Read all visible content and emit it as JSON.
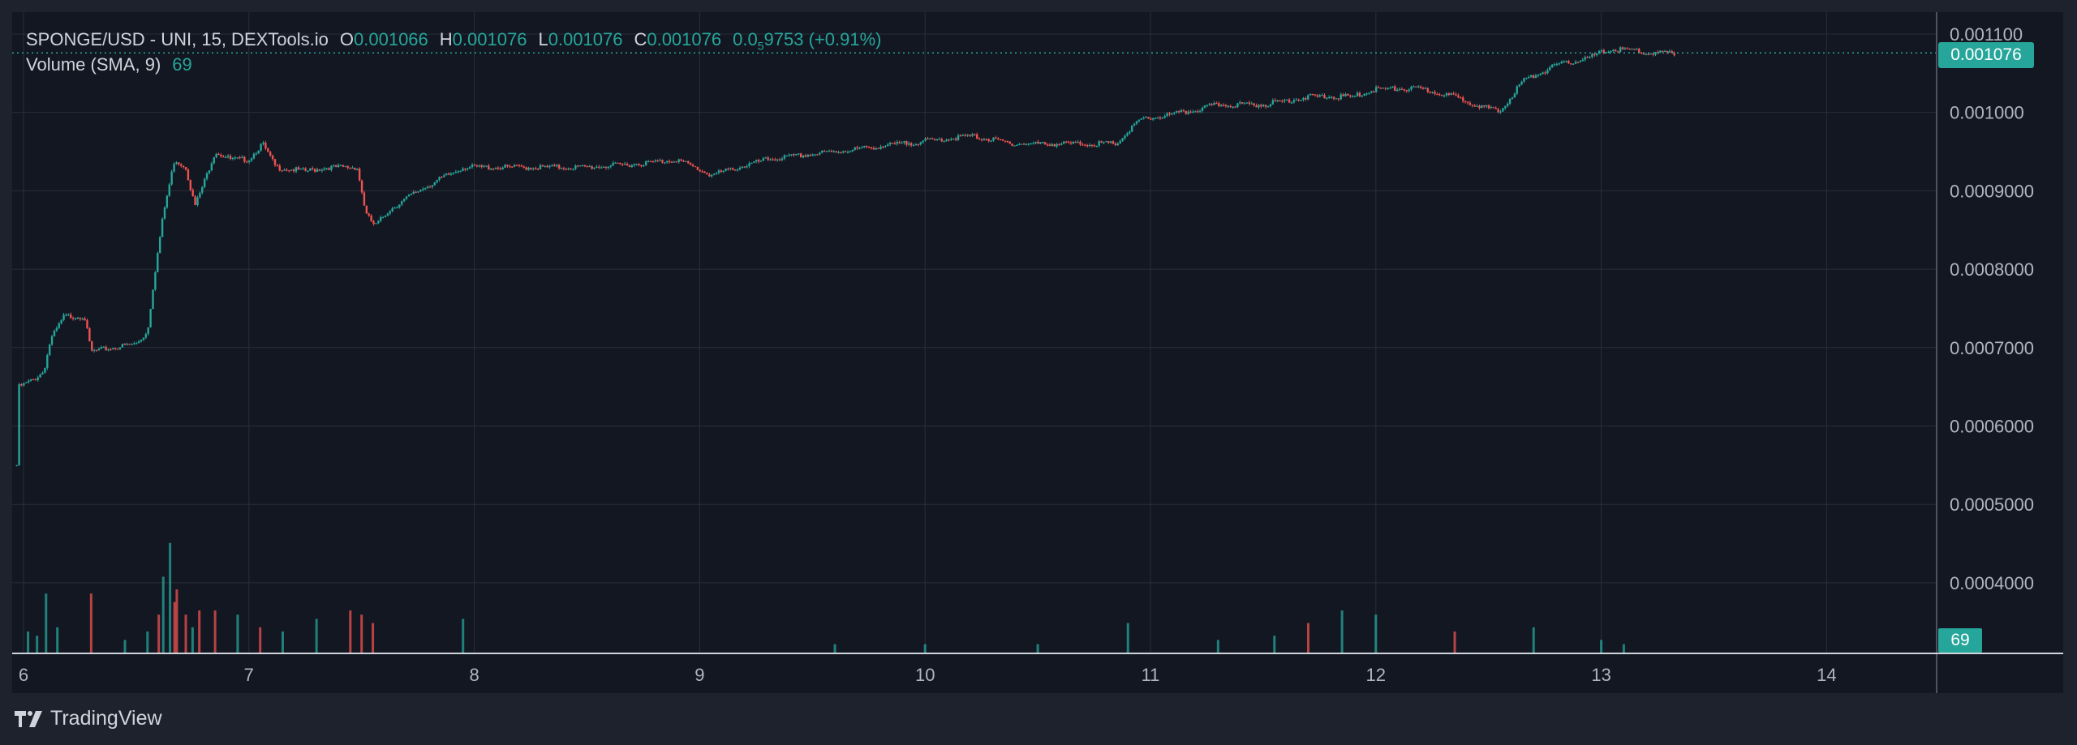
{
  "legend": {
    "symbol": "SPONGE/USD - UNI, 15, DEXTools.io",
    "o_label": "O",
    "o_value": "0.001066",
    "h_label": "H",
    "h_value": "0.001076",
    "l_label": "L",
    "l_value": "0.001076",
    "c_label": "C",
    "c_value": "0.001076",
    "change_prefix": "0.0",
    "change_sub": "5",
    "change_rest": "9753",
    "change_pct": "(+0.91%)",
    "volume_label": "Volume (SMA, 9)",
    "volume_value": "69"
  },
  "badges": {
    "last_price": "0.001076",
    "last_volume": "69"
  },
  "branding": {
    "name": "TradingView"
  },
  "colors": {
    "background": "#131722",
    "frame": "#1e222d",
    "grid": "#2a2e39",
    "up": "#26a69a",
    "down": "#ef5350",
    "text": "#d1d4dc",
    "axis_text": "#b2b5be"
  },
  "chart_data": {
    "type": "candlestick",
    "title": "SPONGE/USD - UNI, 15, DEXTools.io",
    "interval": "15",
    "x_ticks": [
      "6",
      "7",
      "8",
      "9",
      "10",
      "11",
      "12",
      "13",
      "14"
    ],
    "y_ticks": [
      "0.001100",
      "0.001000",
      "0.0009000",
      "0.0008000",
      "0.0007000",
      "0.0006000",
      "0.0005000",
      "0.0004000"
    ],
    "x_range_days": [
      5.96,
      14.53
    ],
    "y_range": [
      0.00032,
      0.00113
    ],
    "last_price": 0.001076,
    "grid": true,
    "price_path": [
      [
        5.97,
        0.00055
      ],
      [
        5.98,
        0.00065
      ],
      [
        6.05,
        0.00066
      ],
      [
        6.09,
        0.00067
      ],
      [
        6.12,
        0.00071
      ],
      [
        6.18,
        0.00074
      ],
      [
        6.27,
        0.00074
      ],
      [
        6.3,
        0.000695
      ],
      [
        6.4,
        0.0007
      ],
      [
        6.5,
        0.000705
      ],
      [
        6.55,
        0.00072
      ],
      [
        6.58,
        0.00079
      ],
      [
        6.62,
        0.00087
      ],
      [
        6.67,
        0.00094
      ],
      [
        6.72,
        0.00093
      ],
      [
        6.76,
        0.00088
      ],
      [
        6.8,
        0.00091
      ],
      [
        6.85,
        0.00095
      ],
      [
        6.92,
        0.00094
      ],
      [
        7.0,
        0.00094
      ],
      [
        7.06,
        0.00096
      ],
      [
        7.12,
        0.00093
      ],
      [
        7.25,
        0.000925
      ],
      [
        7.35,
        0.00093
      ],
      [
        7.48,
        0.00093
      ],
      [
        7.52,
        0.00087
      ],
      [
        7.56,
        0.000855
      ],
      [
        7.62,
        0.000875
      ],
      [
        7.75,
        0.0009
      ],
      [
        7.95,
        0.00093
      ],
      [
        8.2,
        0.00093
      ],
      [
        8.5,
        0.00093
      ],
      [
        8.75,
        0.000935
      ],
      [
        8.9,
        0.00094
      ],
      [
        9.05,
        0.00092
      ],
      [
        9.3,
        0.00094
      ],
      [
        9.6,
        0.00095
      ],
      [
        9.9,
        0.00096
      ],
      [
        10.2,
        0.00097
      ],
      [
        10.4,
        0.00096
      ],
      [
        10.6,
        0.00096
      ],
      [
        10.85,
        0.00096
      ],
      [
        10.95,
        0.00099
      ],
      [
        11.15,
        0.001
      ],
      [
        11.3,
        0.00101
      ],
      [
        11.5,
        0.00101
      ],
      [
        11.7,
        0.00102
      ],
      [
        11.9,
        0.00102
      ],
      [
        12.0,
        0.00103
      ],
      [
        12.2,
        0.00103
      ],
      [
        12.35,
        0.00102
      ],
      [
        12.55,
        0.001
      ],
      [
        12.65,
        0.00104
      ],
      [
        12.8,
        0.00106
      ],
      [
        12.95,
        0.00107
      ],
      [
        13.03,
        0.00108
      ],
      [
        13.15,
        0.00108
      ],
      [
        13.2,
        0.001075
      ],
      [
        13.33,
        0.001076
      ]
    ],
    "volume": {
      "name": "Volume (SMA, 9)",
      "last": 69,
      "bars": [
        [
          6.02,
          5,
          "up"
        ],
        [
          6.06,
          4,
          "up"
        ],
        [
          6.1,
          14,
          "up"
        ],
        [
          6.15,
          6,
          "up"
        ],
        [
          6.3,
          14,
          "down"
        ],
        [
          6.45,
          3,
          "up"
        ],
        [
          6.55,
          5,
          "up"
        ],
        [
          6.6,
          9,
          "down"
        ],
        [
          6.62,
          18,
          "up"
        ],
        [
          6.65,
          26,
          "up"
        ],
        [
          6.67,
          12,
          "down"
        ],
        [
          6.68,
          15,
          "down"
        ],
        [
          6.72,
          9,
          "down"
        ],
        [
          6.75,
          6,
          "up"
        ],
        [
          6.78,
          10,
          "down"
        ],
        [
          6.85,
          10,
          "down"
        ],
        [
          6.95,
          9,
          "up"
        ],
        [
          7.05,
          6,
          "down"
        ],
        [
          7.15,
          5,
          "up"
        ],
        [
          7.3,
          8,
          "up"
        ],
        [
          7.45,
          10,
          "down"
        ],
        [
          7.5,
          9,
          "down"
        ],
        [
          7.55,
          7,
          "down"
        ],
        [
          7.95,
          8,
          "up"
        ],
        [
          9.6,
          2,
          "up"
        ],
        [
          10.0,
          2,
          "up"
        ],
        [
          10.5,
          2,
          "up"
        ],
        [
          10.9,
          7,
          "up"
        ],
        [
          11.3,
          3,
          "up"
        ],
        [
          11.55,
          4,
          "up"
        ],
        [
          11.7,
          7,
          "down"
        ],
        [
          11.85,
          10,
          "up"
        ],
        [
          12.0,
          9,
          "up"
        ],
        [
          12.35,
          5,
          "down"
        ],
        [
          12.7,
          6,
          "up"
        ],
        [
          13.0,
          3,
          "up"
        ],
        [
          13.1,
          2,
          "up"
        ]
      ]
    }
  }
}
